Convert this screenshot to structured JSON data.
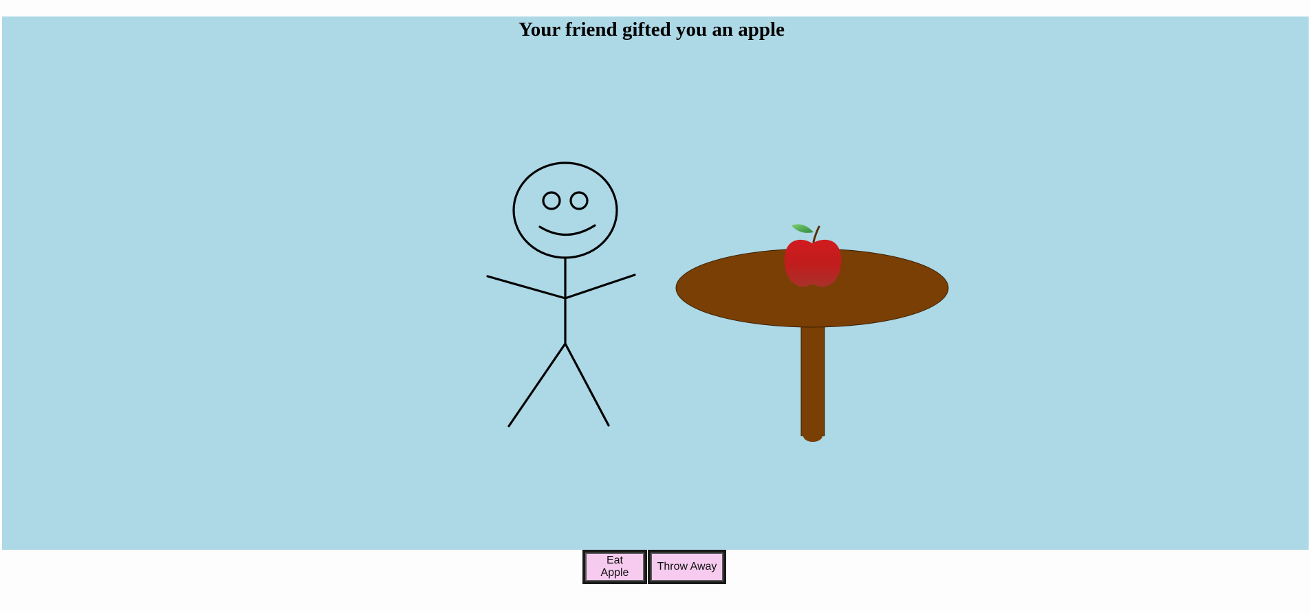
{
  "scene": {
    "title": "Your friend gifted you an apple",
    "background": "#add8e6",
    "character": "stick-figure-smiling",
    "table_color": "#7a3f04",
    "apple_color": "#c4191b",
    "leaf_color": "#3aa14a"
  },
  "controls": {
    "eat_label": "Eat Apple",
    "throw_label": "Throw Away",
    "button_color": "#f6cbef"
  }
}
